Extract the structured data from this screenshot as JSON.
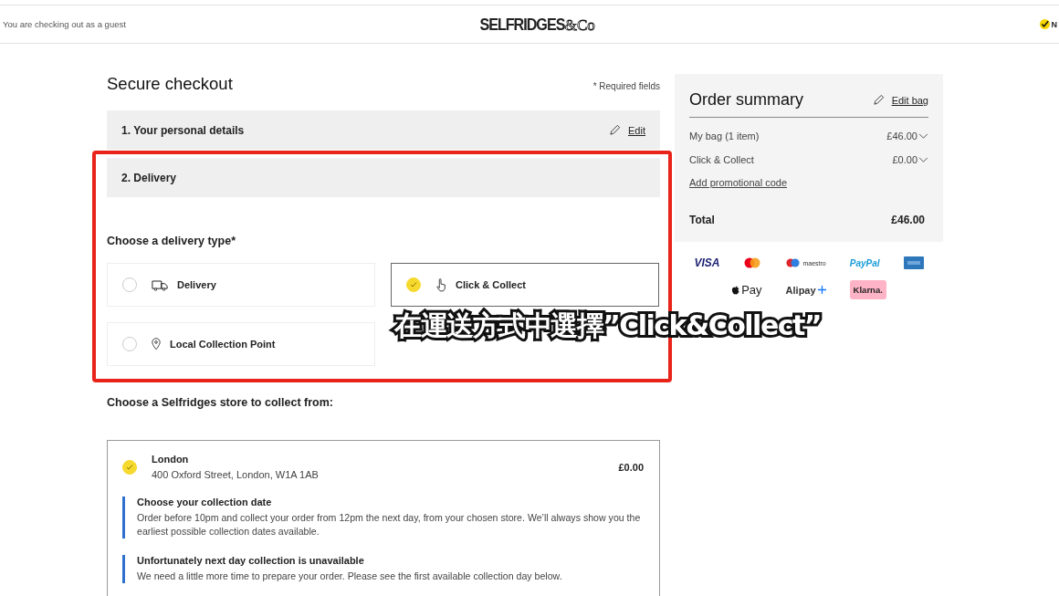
{
  "header": {
    "guest_note": "You are checking out as a guest",
    "logo": {
      "main": "SELFRIDGES",
      "suffix": "&Co"
    },
    "corner_text": "N"
  },
  "checkout": {
    "title": "Secure checkout",
    "required_note": "* Required fields",
    "sections": [
      {
        "label": "1. Your personal details",
        "edit": "Edit"
      },
      {
        "label": "2. Delivery"
      }
    ],
    "delivery_type_label": "Choose a delivery type*",
    "delivery_options": [
      {
        "kind": "truck",
        "label": "Delivery",
        "selected": false
      },
      {
        "kind": "hand",
        "label": "Click & Collect",
        "selected": true
      },
      {
        "kind": "pin",
        "label": "Local Collection Point",
        "selected": false
      }
    ],
    "store_label": "Choose a Selfridges store to collect from:",
    "store": {
      "name": "London",
      "address": "400 Oxford Street, London, W1A 1AB",
      "price": "£0.00",
      "selected": true,
      "notes": [
        {
          "title": "Choose your collection date",
          "text": "Order before 10pm and collect your order from 12pm the next day, from your chosen store. We’ll always show you the earliest possible collection dates available."
        },
        {
          "title": "Unfortunately next day collection is unavailable",
          "text": "We need a little more time to prepare your order. Please see the first available collection day below."
        }
      ]
    }
  },
  "summary": {
    "title": "Order summary",
    "edit": "Edit bag",
    "lines": [
      {
        "label": "My bag (1 item)",
        "value": "£46.00"
      },
      {
        "label": "Click & Collect",
        "value": "£0.00"
      }
    ],
    "promo": "Add promotional code",
    "total_label": "Total",
    "total_value": "£46.00"
  },
  "payment_methods": [
    {
      "kind": "visa",
      "label": "VISA"
    },
    {
      "kind": "mastercard"
    },
    {
      "kind": "maestro",
      "label": "maestro"
    },
    {
      "kind": "paypal",
      "label": "PayPal"
    },
    {
      "kind": "amex"
    },
    {
      "kind": "applepay",
      "label": "Pay"
    },
    {
      "kind": "alipay",
      "label": "Alipay"
    },
    {
      "kind": "klarna",
      "label": "Klarna."
    }
  ],
  "annotation": {
    "caption": "在運送方式中選擇”Click&Collect”"
  }
}
